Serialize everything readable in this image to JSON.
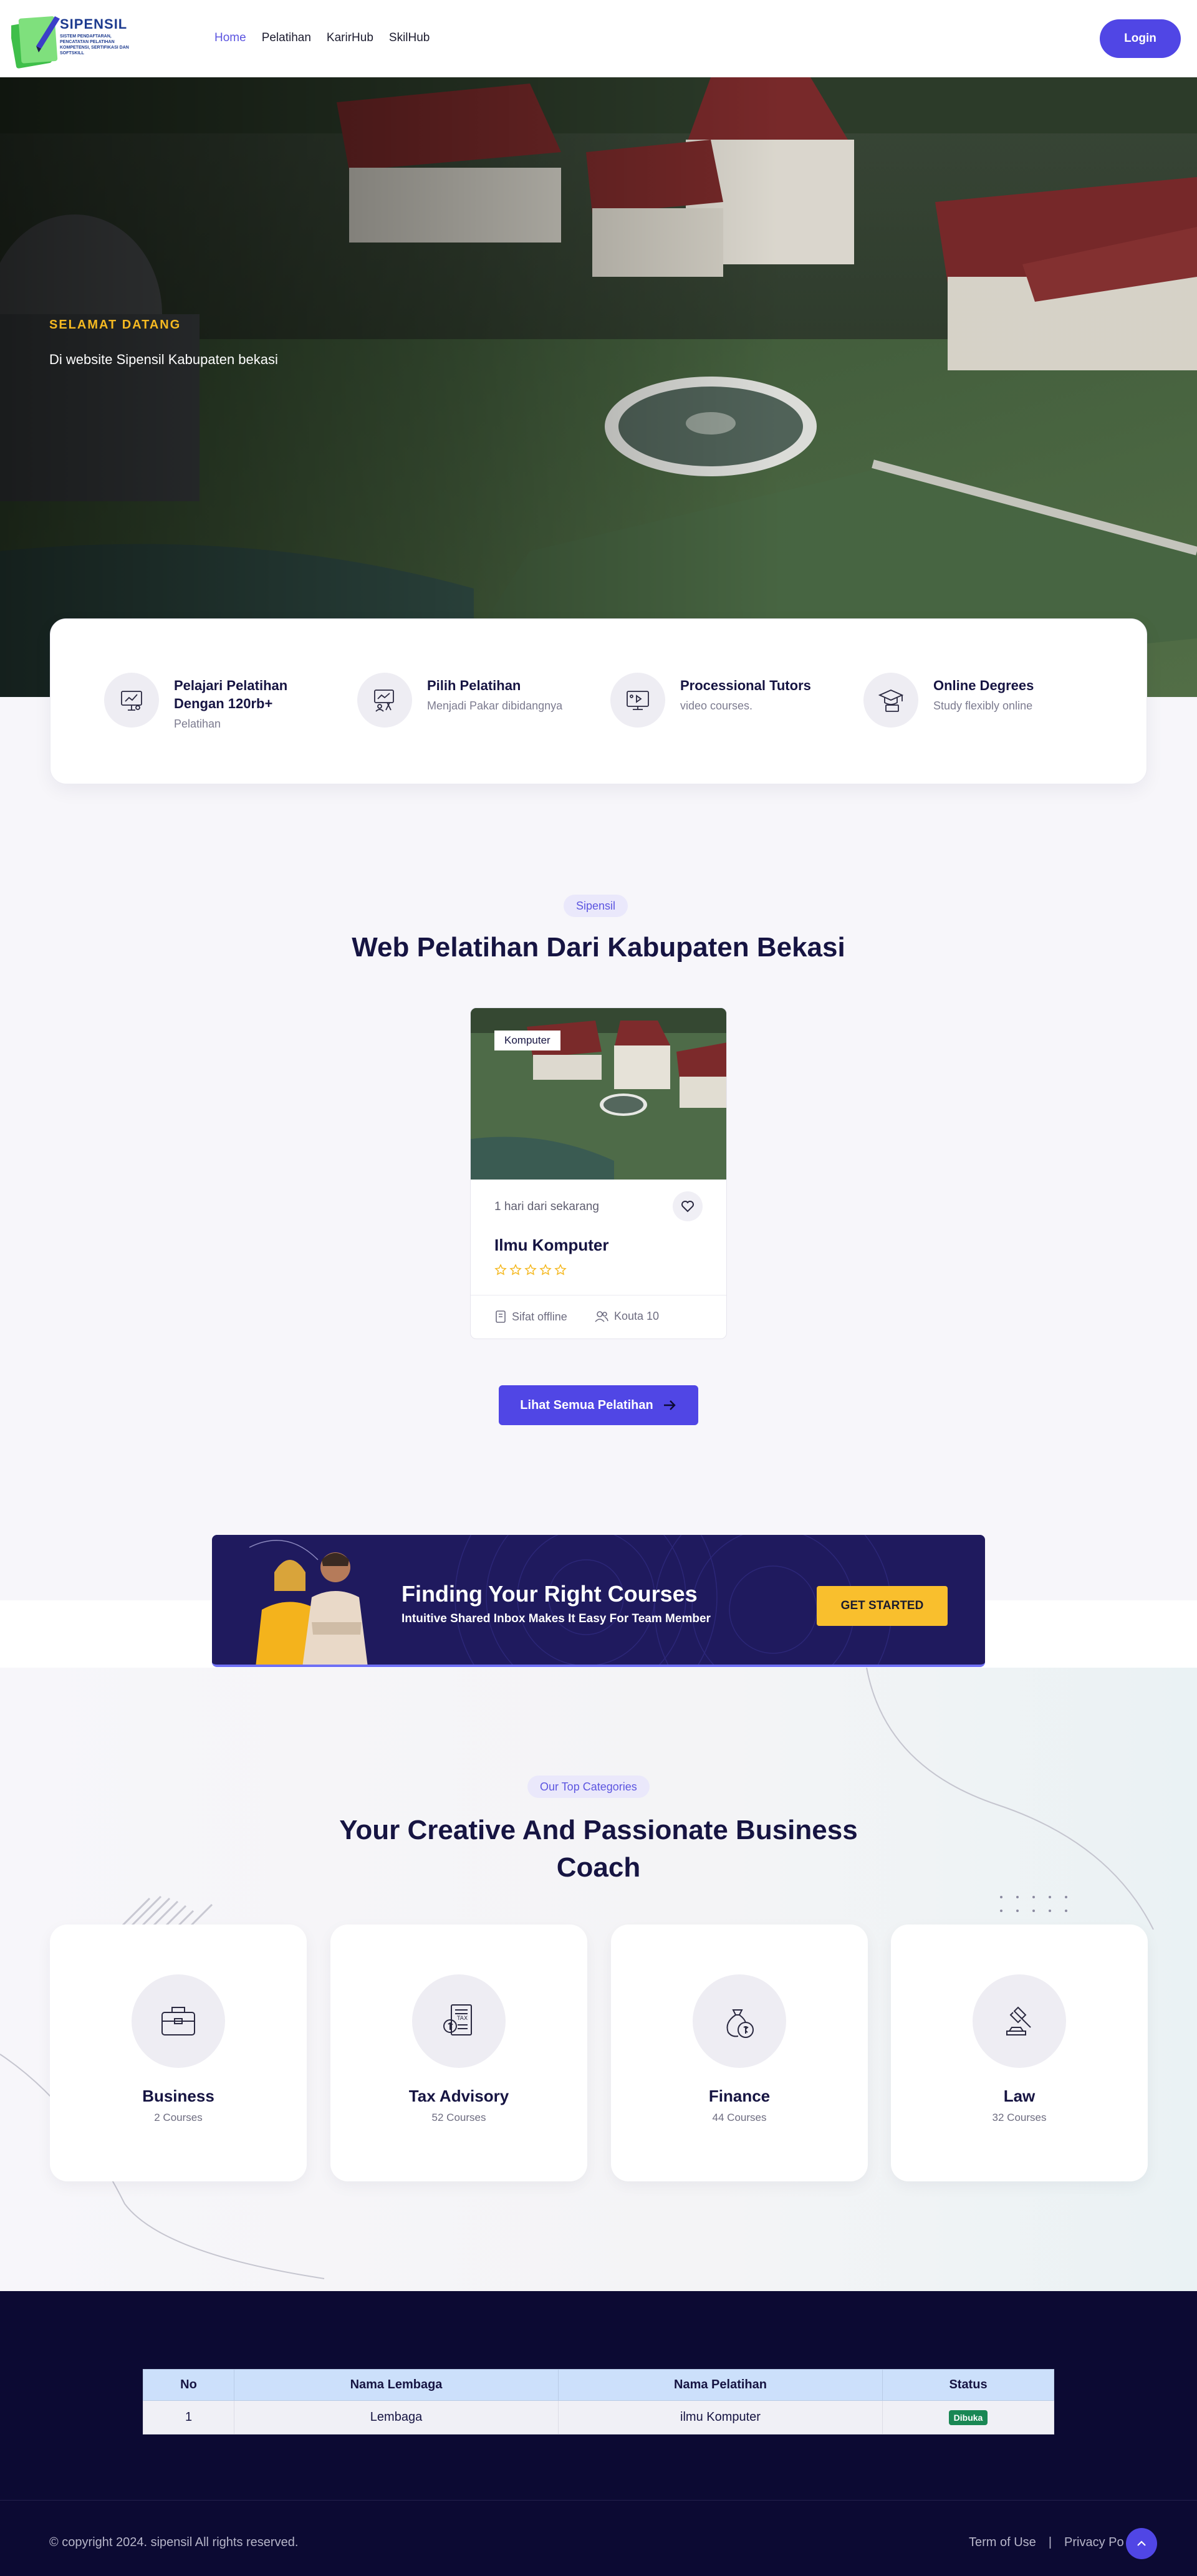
{
  "header": {
    "logo_title": "SIPENSIL",
    "logo_subtitle": "SISTEM PENDAFTARAN, PENCATATAN PELATIHAN KOMPETENSI, SERTIFIKASI DAN SOFTSKILL",
    "nav": [
      {
        "label": "Home",
        "active": true
      },
      {
        "label": "Pelatihan",
        "active": false
      },
      {
        "label": "KarirHub",
        "active": false
      },
      {
        "label": "SkilHub",
        "active": false
      }
    ],
    "login_label": "Login"
  },
  "hero": {
    "kicker": "SELAMAT DATANG",
    "text": "Di website Sipensil Kabupaten bekasi"
  },
  "features": [
    {
      "icon": "presentation-icon",
      "title": "Pelajari Pelatihan Dengan 120rb+",
      "subtitle": "Pelatihan"
    },
    {
      "icon": "teacher-board-icon",
      "title": "Pilih Pelatihan",
      "subtitle": "Menjadi Pakar dibidangnya"
    },
    {
      "icon": "video-tutor-icon",
      "title": "Processional Tutors",
      "subtitle": "video courses."
    },
    {
      "icon": "graduation-icon",
      "title": "Online Degrees",
      "subtitle": "Study flexibly online"
    }
  ],
  "courses_section": {
    "pill": "Sipensil",
    "title": "Web Pelatihan Dari Kabupaten Bekasi",
    "course": {
      "tag": "Komputer",
      "time": "1 hari dari sekarang",
      "title": "Ilmu Komputer",
      "rating": 0,
      "meta_type": "Sifat offline",
      "meta_quota": "Kouta 10"
    },
    "view_all_label": "Lihat Semua Pelatihan"
  },
  "banner": {
    "title": "Finding Your Right Courses",
    "subtitle": "Intuitive Shared Inbox Makes It Easy For Team Member",
    "button": "GET STARTED"
  },
  "categories": {
    "pill": "Our Top Categories",
    "title_line1": "Your Creative And Passionate Business",
    "title_line2": "Coach",
    "items": [
      {
        "icon": "briefcase-icon",
        "name": "Business",
        "count": "2 Courses"
      },
      {
        "icon": "tax-document-icon",
        "name": "Tax Advisory",
        "count": "52 Courses"
      },
      {
        "icon": "money-bag-icon",
        "name": "Finance",
        "count": "44 Courses"
      },
      {
        "icon": "gavel-icon",
        "name": "Law",
        "count": "32 Courses"
      }
    ]
  },
  "table": {
    "headers": [
      "No",
      "Nama Lembaga",
      "Nama Pelatihan",
      "Status"
    ],
    "rows": [
      {
        "no": "1",
        "lembaga": "Lembaga",
        "pelatihan": "ilmu Komputer",
        "status": "Dibuka"
      }
    ]
  },
  "footer": {
    "copyright": "© copyright 2024. sipensil All rights reserved.",
    "terms": "Term of Use",
    "separator": "|",
    "privacy": "Privacy Po"
  },
  "colors": {
    "primary": "#5046e5",
    "accent_yellow": "#f5b921",
    "dark_navy": "#0c0a33",
    "status_green": "#198754"
  }
}
